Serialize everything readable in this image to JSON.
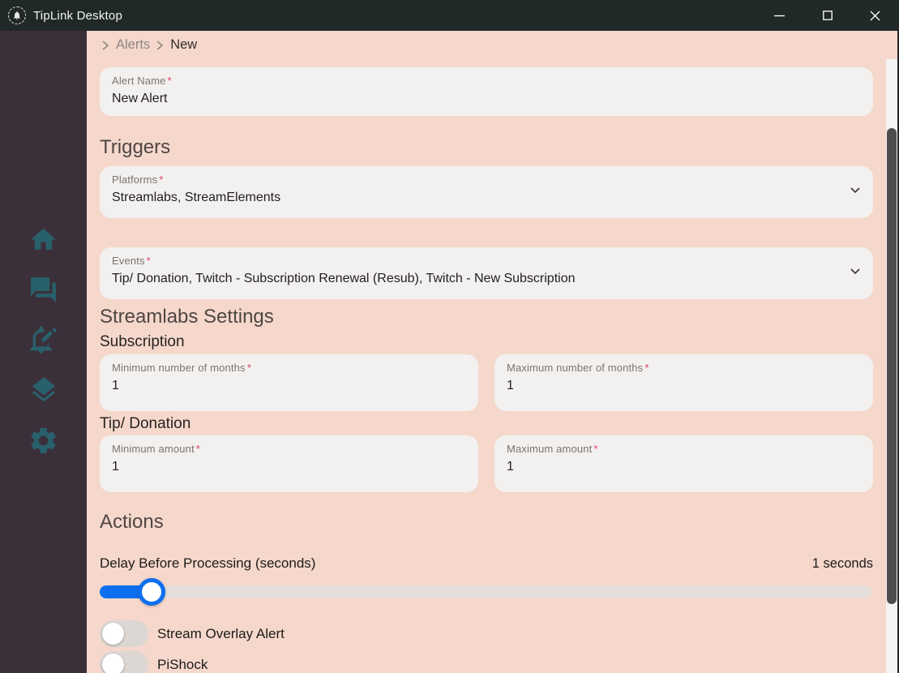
{
  "window": {
    "title": "TipLink Desktop",
    "controls": {
      "minimize": "minimize",
      "maximize": "maximize",
      "close": "close"
    }
  },
  "breadcrumb": {
    "items": [
      {
        "label": "Alerts"
      },
      {
        "label": "New"
      }
    ]
  },
  "sidebar": {
    "items": [
      {
        "icon": "home-icon"
      },
      {
        "icon": "chat-icon"
      },
      {
        "icon": "edit-alert-icon"
      },
      {
        "icon": "layers-icon"
      },
      {
        "icon": "settings-icon"
      }
    ]
  },
  "form": {
    "required_marker": "*",
    "alert_name": {
      "label": "Alert Name",
      "value": "New Alert"
    },
    "sections": {
      "triggers": "Triggers",
      "streamlabs": "Streamlabs Settings",
      "subscription": "Subscription",
      "tip_donation": "Tip/ Donation",
      "actions": "Actions"
    },
    "platforms": {
      "label": "Platforms",
      "value": "Streamlabs, StreamElements"
    },
    "events": {
      "label": "Events",
      "value": "Tip/ Donation, Twitch - Subscription Renewal (Resub), Twitch - New Subscription"
    },
    "min_months": {
      "label": "Minimum number of months",
      "value": "1"
    },
    "max_months": {
      "label": "Maximum number of months",
      "value": "1"
    },
    "min_amount": {
      "label": "Minimum amount",
      "value": "1"
    },
    "max_amount": {
      "label": "Maximum amount",
      "value": "1"
    },
    "delay": {
      "label": "Delay Before Processing (seconds)",
      "value": 1,
      "value_label": "1 seconds"
    },
    "toggles": {
      "overlay": {
        "label": "Stream Overlay Alert",
        "state": "off"
      },
      "pishock": {
        "label": "PiShock",
        "state": "off"
      }
    }
  },
  "colors": {
    "titlebar": "#212928",
    "sidebar": "#3b2f3a",
    "icon_teal": "#28606b",
    "background_pink": "#f5d8cb",
    "card": "#f2f1f0",
    "accent_blue": "#0d6ff0",
    "required": "#e23a6d",
    "scroll_thumb": "#4d4d4d"
  }
}
